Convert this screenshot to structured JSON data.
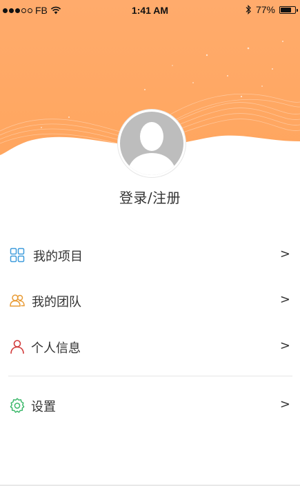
{
  "status_bar": {
    "carrier": "FB",
    "time": "1:41 AM",
    "battery_percent": "77%",
    "battery_level": 0.77
  },
  "theme": {
    "header_orange": "#ffaa6a",
    "project_blue": "#3d9bdc",
    "team_orange": "#e89a33",
    "person_red": "#d23b3b",
    "settings_green": "#3cb86a"
  },
  "profile": {
    "login_label": "登录/注册"
  },
  "menu": {
    "items": [
      {
        "label": "我的项目",
        "icon": "grid-icon",
        "chevron": ">"
      },
      {
        "label": "我的团队",
        "icon": "team-icon",
        "chevron": ">"
      },
      {
        "label": "个人信息",
        "icon": "person-icon",
        "chevron": ">"
      },
      {
        "label": "设置",
        "icon": "gear-icon",
        "chevron": ">"
      }
    ]
  }
}
